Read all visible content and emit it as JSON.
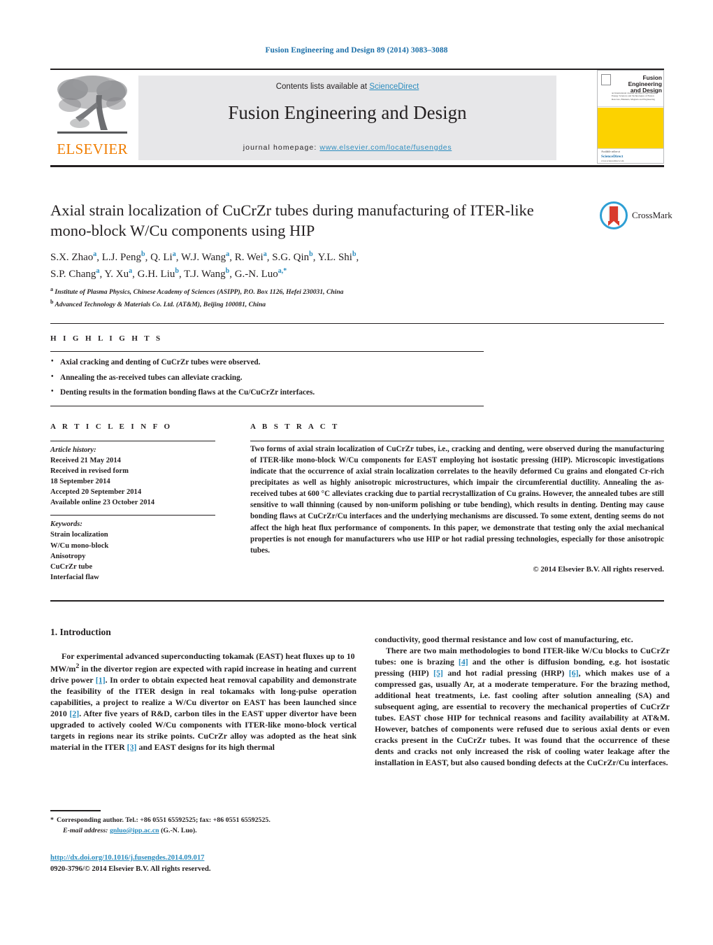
{
  "running_head": "Fusion Engineering and Design 89 (2014) 3083–3088",
  "header": {
    "publisher_name": "ELSEVIER",
    "contents_prefix": "Contents lists available at ",
    "contents_link": "ScienceDirect",
    "journal_name": "Fusion Engineering and Design",
    "homepage_label": "journal homepage:",
    "homepage_url": "www.elsevier.com/locate/fusengdes",
    "cover": {
      "title_line1": "Fusion Engineering",
      "title_line2": "and Design",
      "subtitle": "an International Journal devoted to the Fusion Energy Sciences and Technologies of Fusion Reactors, Blankets, Magnets and Engineering",
      "footer_line1": "Available online at",
      "footer_line2": "ScienceDirect",
      "footer_line3": "www.sciencedirect.com",
      "accent_color": "#fcd200"
    }
  },
  "article": {
    "title": "Axial strain localization of CuCrZr tubes during manufacturing of ITER-like mono-block W/Cu components using HIP",
    "crossmark_label": "CrossMark",
    "authors_line1": "S.X. Zhao a, L.J. Peng b, Q. Li a, W.J. Wang a, R. Wei a, S.G. Qin b, Y.L. Shi b,",
    "authors_line2": "S.P. Chang a, Y. Xu a, G.H. Liu b, T.J. Wang b, G.-N. Luo a,*",
    "affiliation_a": "Institute of Plasma Physics, Chinese Academy of Sciences (ASIPP), P.O. Box 1126, Hefei 230031, China",
    "affiliation_b": "Advanced Technology & Materials Co. Ltd. (AT&M), Beijing 100081, China"
  },
  "highlights": {
    "label": "H I G H L I G H T S",
    "items": [
      "Axial cracking and denting of CuCrZr tubes were observed.",
      "Annealing the as-received tubes can alleviate cracking.",
      "Denting results in the formation bonding flaws at the Cu/CuCrZr interfaces."
    ]
  },
  "article_info": {
    "label": "A R T I C L E   I N F O",
    "history_label": "Article history:",
    "history": [
      "Received 21 May 2014",
      "Received in revised form",
      "18 September 2014",
      "Accepted 20 September 2014",
      "Available online 23 October 2014"
    ],
    "keywords_label": "Keywords:",
    "keywords": [
      "Strain localization",
      "W/Cu mono-block",
      "Anisotropy",
      "CuCrZr tube",
      "Interfacial flaw"
    ]
  },
  "abstract": {
    "label": "A B S T R A C T",
    "text": "Two forms of axial strain localization of CuCrZr tubes, i.e., cracking and denting, were observed during the manufacturing of ITER-like mono-block W/Cu components for EAST employing hot isostatic pressing (HIP). Microscopic investigations indicate that the occurrence of axial strain localization correlates to the heavily deformed Cu grains and elongated Cr-rich precipitates as well as highly anisotropic microstructures, which impair the circumferential ductility. Annealing the as-received tubes at 600 °C alleviates cracking due to partial recrystallization of Cu grains. However, the annealed tubes are still sensitive to wall thinning (caused by non-uniform polishing or tube bending), which results in denting. Denting may cause bonding flaws at CuCrZr/Cu interfaces and the underlying mechanisms are discussed. To some extent, denting seems do not affect the high heat flux performance of components. In this paper, we demonstrate that testing only the axial mechanical properties is not enough for manufacturers who use HIP or hot radial pressing technologies, especially for those anisotropic tubes.",
    "copyright": "© 2014 Elsevier B.V. All rights reserved."
  },
  "body": {
    "section_heading": "1. Introduction",
    "left_paragraph": "For experimental advanced superconducting tokamak (EAST) heat fluxes up to 10 MW/m2 in the divertor region are expected with rapid increase in heating and current drive power [1]. In order to obtain expected heat removal capability and demonstrate the feasibility of the ITER design in real tokamaks with long-pulse operation capabilities, a project to realize a W/Cu divertor on EAST has been launched since 2010 [2]. After five years of R&D, carbon tiles in the EAST upper divertor have been upgraded to actively cooled W/Cu components with ITER-like mono-block vertical targets in regions near its strike points. CuCrZr alloy was adopted as the heat sink material in the ITER [3] and EAST designs for its high thermal",
    "right_paragraph_1": "conductivity, good thermal resistance and low cost of manufacturing, etc.",
    "right_paragraph_2": "There are two main methodologies to bond ITER-like W/Cu blocks to CuCrZr tubes: one is brazing [4] and the other is diffusion bonding, e.g. hot isostatic pressing (HIP) [5] and hot radial pressing (HRP) [6], which makes use of a compressed gas, usually Ar, at a moderate temperature. For the brazing method, additional heat treatments, i.e. fast cooling after solution annealing (SA) and subsequent aging, are essential to recovery the mechanical properties of CuCrZr tubes. EAST chose HIP for technical reasons and facility availability at AT&M. However, batches of components were refused due to serious axial dents or even cracks present in the CuCrZr tubes. It was found that the occurrence of these dents and cracks not only increased the risk of cooling water leakage after the installation in EAST, but also caused bonding defects at the CuCrZr/Cu interfaces.",
    "references_inline": [
      "[1]",
      "[2]",
      "[3]",
      "[4]",
      "[5]",
      "[6]"
    ]
  },
  "footer": {
    "corresponding_marker": "*",
    "corresponding_text": "Corresponding author. Tel.: +86 0551 65592525; fax: +86 0551 65592525.",
    "email_label": "E-mail address:",
    "email": "gnluo@ipp.ac.cn",
    "email_owner": "(G.-N. Luo).",
    "doi_url": "http://dx.doi.org/10.1016/j.fusengdes.2014.09.017",
    "issn_line": "0920-3796/© 2014 Elsevier B.V. All rights reserved."
  },
  "colors": {
    "link": "#2b8cbe",
    "running_head": "#1a6ea8",
    "elsevier_orange": "#f07d00",
    "band_gray": "#e7e7e9",
    "cover_yellow": "#fcd200",
    "crossmark_blue": "#2e9fd4",
    "crossmark_red": "#d83b2c"
  }
}
